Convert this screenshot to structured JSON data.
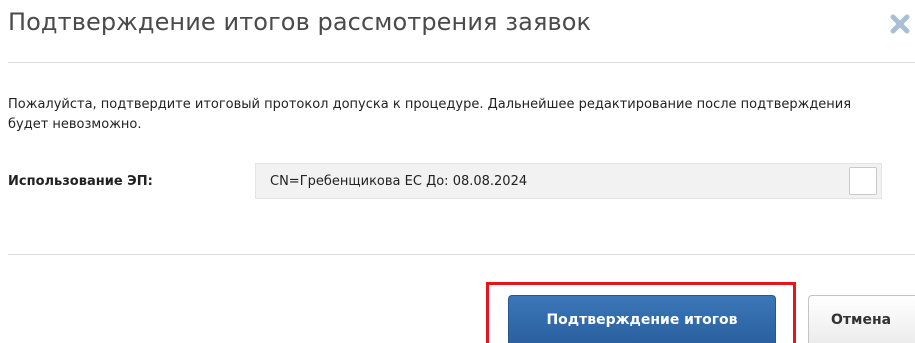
{
  "dialog": {
    "title": "Подтверждение итогов рассмотрения заявок",
    "close_icon": "close-icon",
    "message": "Пожалуйста, подтвердите итоговый протокол допуска к процедуре. Дальнейшее редактирование после подтверждения будет невозможно.",
    "signature": {
      "label": "Использование ЭП:",
      "selected_value": "CN=Гребенщикова ЕС До: 08.08.2024"
    },
    "buttons": {
      "confirm_label": "Подтверждение итогов",
      "cancel_label": "Отмена"
    }
  },
  "colors": {
    "primary_button": "#2e67a8",
    "highlight_border": "#e8141c",
    "close_icon": "#a9bfd3"
  }
}
